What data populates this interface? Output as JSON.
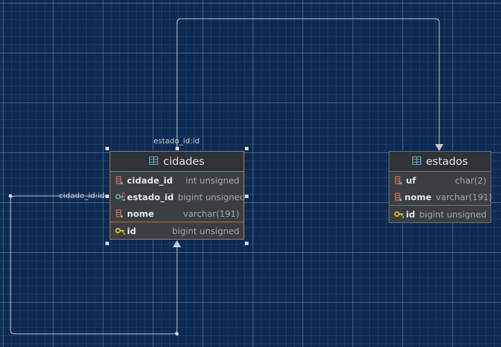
{
  "tables": {
    "cidades": {
      "name": "cidades",
      "columns": [
        {
          "name": "cidade_id",
          "type": "int unsigned",
          "icon": "column-icon"
        },
        {
          "name": "estado_id",
          "type": "bigint unsigned",
          "icon": "foreign-key-icon"
        },
        {
          "name": "nome",
          "type": "varchar(191)",
          "icon": "column-icon"
        },
        {
          "name": "id",
          "type": "bigint unsigned",
          "icon": "primary-key-icon"
        }
      ]
    },
    "estados": {
      "name": "estados",
      "columns": [
        {
          "name": "uf",
          "type": "char(2)",
          "icon": "column-icon"
        },
        {
          "name": "nome",
          "type": "varchar(191)",
          "icon": "column-icon"
        },
        {
          "name": "id",
          "type": "bigint unsigned",
          "icon": "primary-key-icon"
        }
      ]
    }
  },
  "relations": [
    {
      "label": "estado_id:id",
      "from": "cidades.estado_id",
      "to": "estados.id"
    },
    {
      "label": "cidade_id:id",
      "from": "cidades.cidade_id",
      "to": "cidades.id"
    }
  ],
  "colors": {
    "canvas": "#0d2a52",
    "selected_border": "#b9783a",
    "edge": "#c8ccd0",
    "key_yellow": "#e8c11c",
    "table_icon": "#5fb3c9"
  }
}
